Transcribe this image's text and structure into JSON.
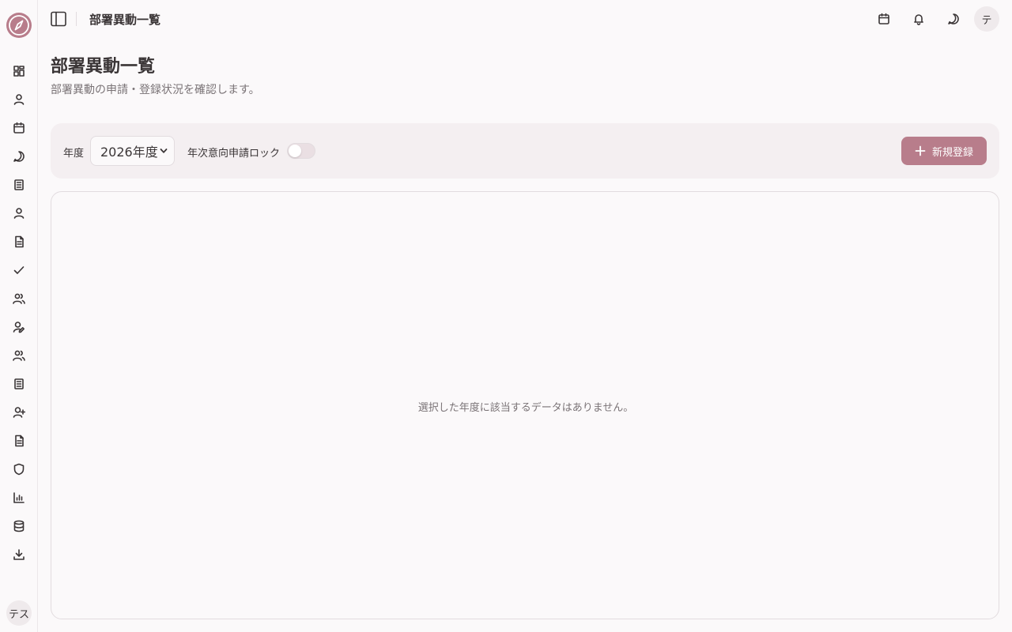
{
  "header": {
    "title": "部署異動一覧",
    "avatar_initial": "テ"
  },
  "sidebar": {
    "avatar_text": "テス",
    "items": [
      {
        "icon": "dashboard-icon"
      },
      {
        "icon": "user-icon"
      },
      {
        "icon": "calendar-icon"
      },
      {
        "icon": "chat-icon"
      },
      {
        "icon": "list-icon"
      },
      {
        "icon": "user-icon"
      },
      {
        "icon": "document-icon"
      },
      {
        "icon": "check-icon"
      },
      {
        "icon": "users-icon"
      },
      {
        "icon": "user-edit-icon"
      },
      {
        "icon": "users-icon"
      },
      {
        "icon": "list-icon"
      },
      {
        "icon": "user-plus-icon"
      },
      {
        "icon": "document-icon"
      },
      {
        "icon": "shield-icon"
      },
      {
        "icon": "bar-chart-icon"
      },
      {
        "icon": "database-icon"
      },
      {
        "icon": "download-icon"
      }
    ]
  },
  "page": {
    "title": "部署異動一覧",
    "subtitle": "部署異動の申請・登録状況を確認します。"
  },
  "filters": {
    "year_label": "年度",
    "year_value": "2026年度",
    "lock_label": "年次意向申請ロック",
    "lock_on": false,
    "new_button_label": "新規登録"
  },
  "table": {
    "empty_message": "選択した年度に該当するデータはありません。"
  },
  "colors": {
    "accent": "#b87d8b",
    "background": "#fbf9fa",
    "filter_bg": "#f4eff1",
    "text": "#3a3536",
    "muted": "#7a7376"
  }
}
